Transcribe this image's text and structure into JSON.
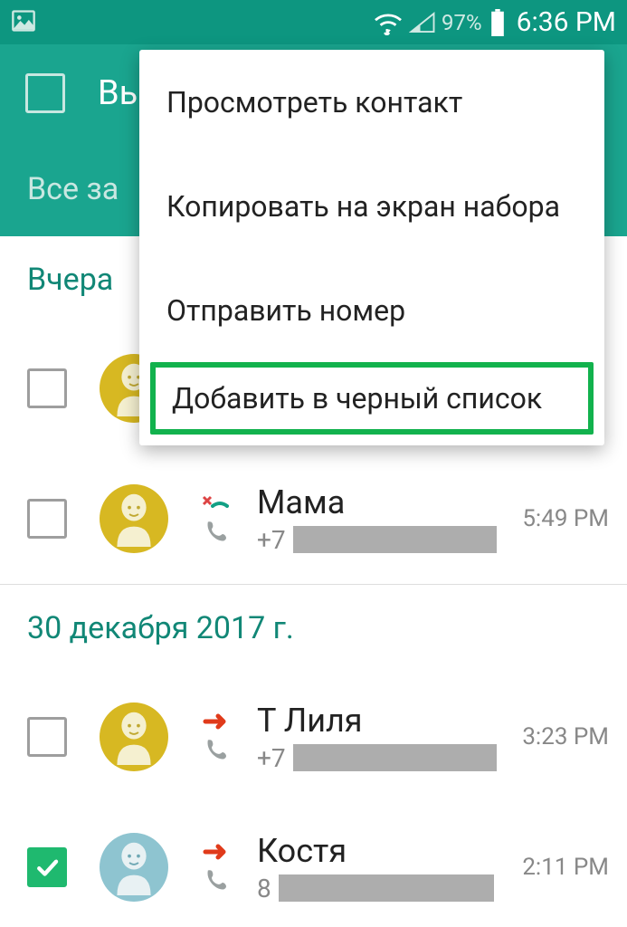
{
  "status": {
    "battery_pct": "97%",
    "clock": "6:36 PM"
  },
  "toolbar": {
    "title": "Вы"
  },
  "tabs": {
    "records": "Все за"
  },
  "sections": [
    {
      "label": "Вчера"
    },
    {
      "label": "30 декабря 2017 г."
    }
  ],
  "rows": [
    {
      "name": "",
      "prefix": "",
      "time": ""
    },
    {
      "name": "Мама",
      "prefix": "+7",
      "time": "5:49 PM"
    },
    {
      "name": "Т Лиля",
      "prefix": "+7",
      "time": "3:23 PM"
    },
    {
      "name": "Костя",
      "prefix": "8",
      "time": "2:11 PM"
    }
  ],
  "menu": {
    "view": "Просмотреть контакт",
    "copy": "Копировать на экран набора",
    "send": "Отправить номер",
    "blacklist": "Добавить в черный список"
  }
}
